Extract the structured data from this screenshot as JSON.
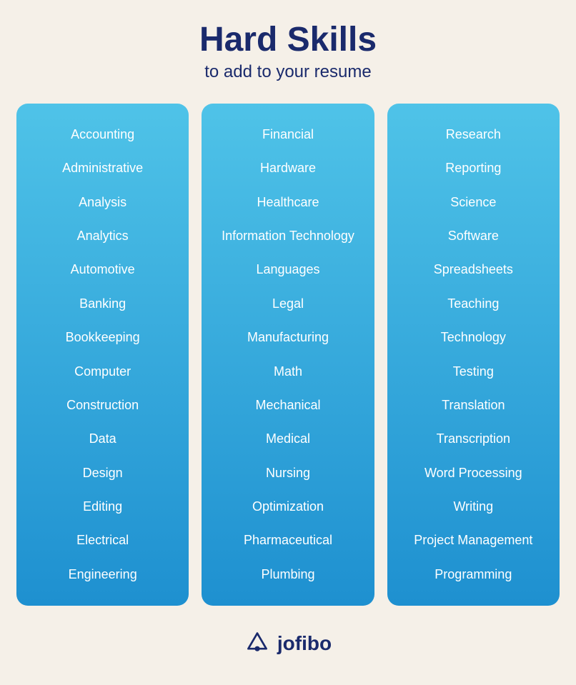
{
  "header": {
    "title": "Hard Skills",
    "subtitle": "to add to your resume"
  },
  "columns": [
    {
      "id": "col1",
      "items": [
        "Accounting",
        "Administrative",
        "Analysis",
        "Analytics",
        "Automotive",
        "Banking",
        "Bookkeeping",
        "Computer",
        "Construction",
        "Data",
        "Design",
        "Editing",
        "Electrical",
        "Engineering"
      ]
    },
    {
      "id": "col2",
      "items": [
        "Financial",
        "Hardware",
        "Healthcare",
        "Information Technology",
        "Languages",
        "Legal",
        "Manufacturing",
        "Math",
        "Mechanical",
        "Medical",
        "Nursing",
        "Optimization",
        "Pharmaceutical",
        "Plumbing"
      ]
    },
    {
      "id": "col3",
      "items": [
        "Research",
        "Reporting",
        "Science",
        "Software",
        "Spreadsheets",
        "Teaching",
        "Technology",
        "Testing",
        "Translation",
        "Transcription",
        "Word Processing",
        "Writing",
        "Project Management",
        "Programming"
      ]
    }
  ],
  "footer": {
    "brand": "jofibo"
  }
}
